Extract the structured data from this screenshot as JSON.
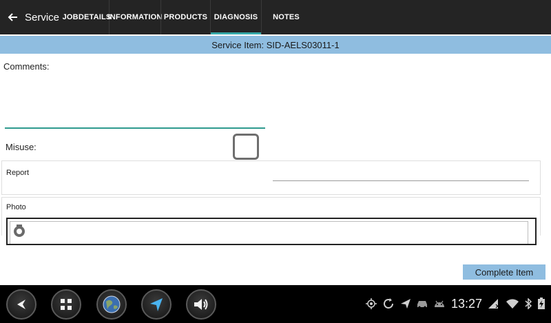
{
  "topbar": {
    "title": "Service",
    "tabs": [
      {
        "label": "JOBDETAILS",
        "active": false
      },
      {
        "label": "INFORMATION",
        "active": false
      },
      {
        "label": "PRODUCTS",
        "active": false
      },
      {
        "label": "DIAGNOSIS",
        "active": true
      },
      {
        "label": "NOTES",
        "active": false
      }
    ]
  },
  "item_header": "Service Item: SID-AELS03011-1",
  "form": {
    "comments_label": "Comments:",
    "comments_value": "",
    "misuse_label": "Misuse:",
    "misuse_checked": false,
    "report_label": "Report",
    "report_value": "",
    "photo_label": "Photo"
  },
  "complete_button": "Complete Item",
  "system_bar": {
    "time": "13:27",
    "nav_icons": [
      "back-icon",
      "apps-grid-icon",
      "globe-icon",
      "navigation-arrow-icon",
      "volume-icon"
    ],
    "status_icons": [
      "gps-icon",
      "sync-icon",
      "navigation-icon",
      "car-icon",
      "android-icon",
      "no-sim-icon",
      "wifi-icon",
      "bluetooth-icon",
      "battery-charging-icon"
    ]
  },
  "colors": {
    "accent": "#36a8a8",
    "header_bg": "#8fbde0",
    "topbar_bg": "#242424"
  }
}
